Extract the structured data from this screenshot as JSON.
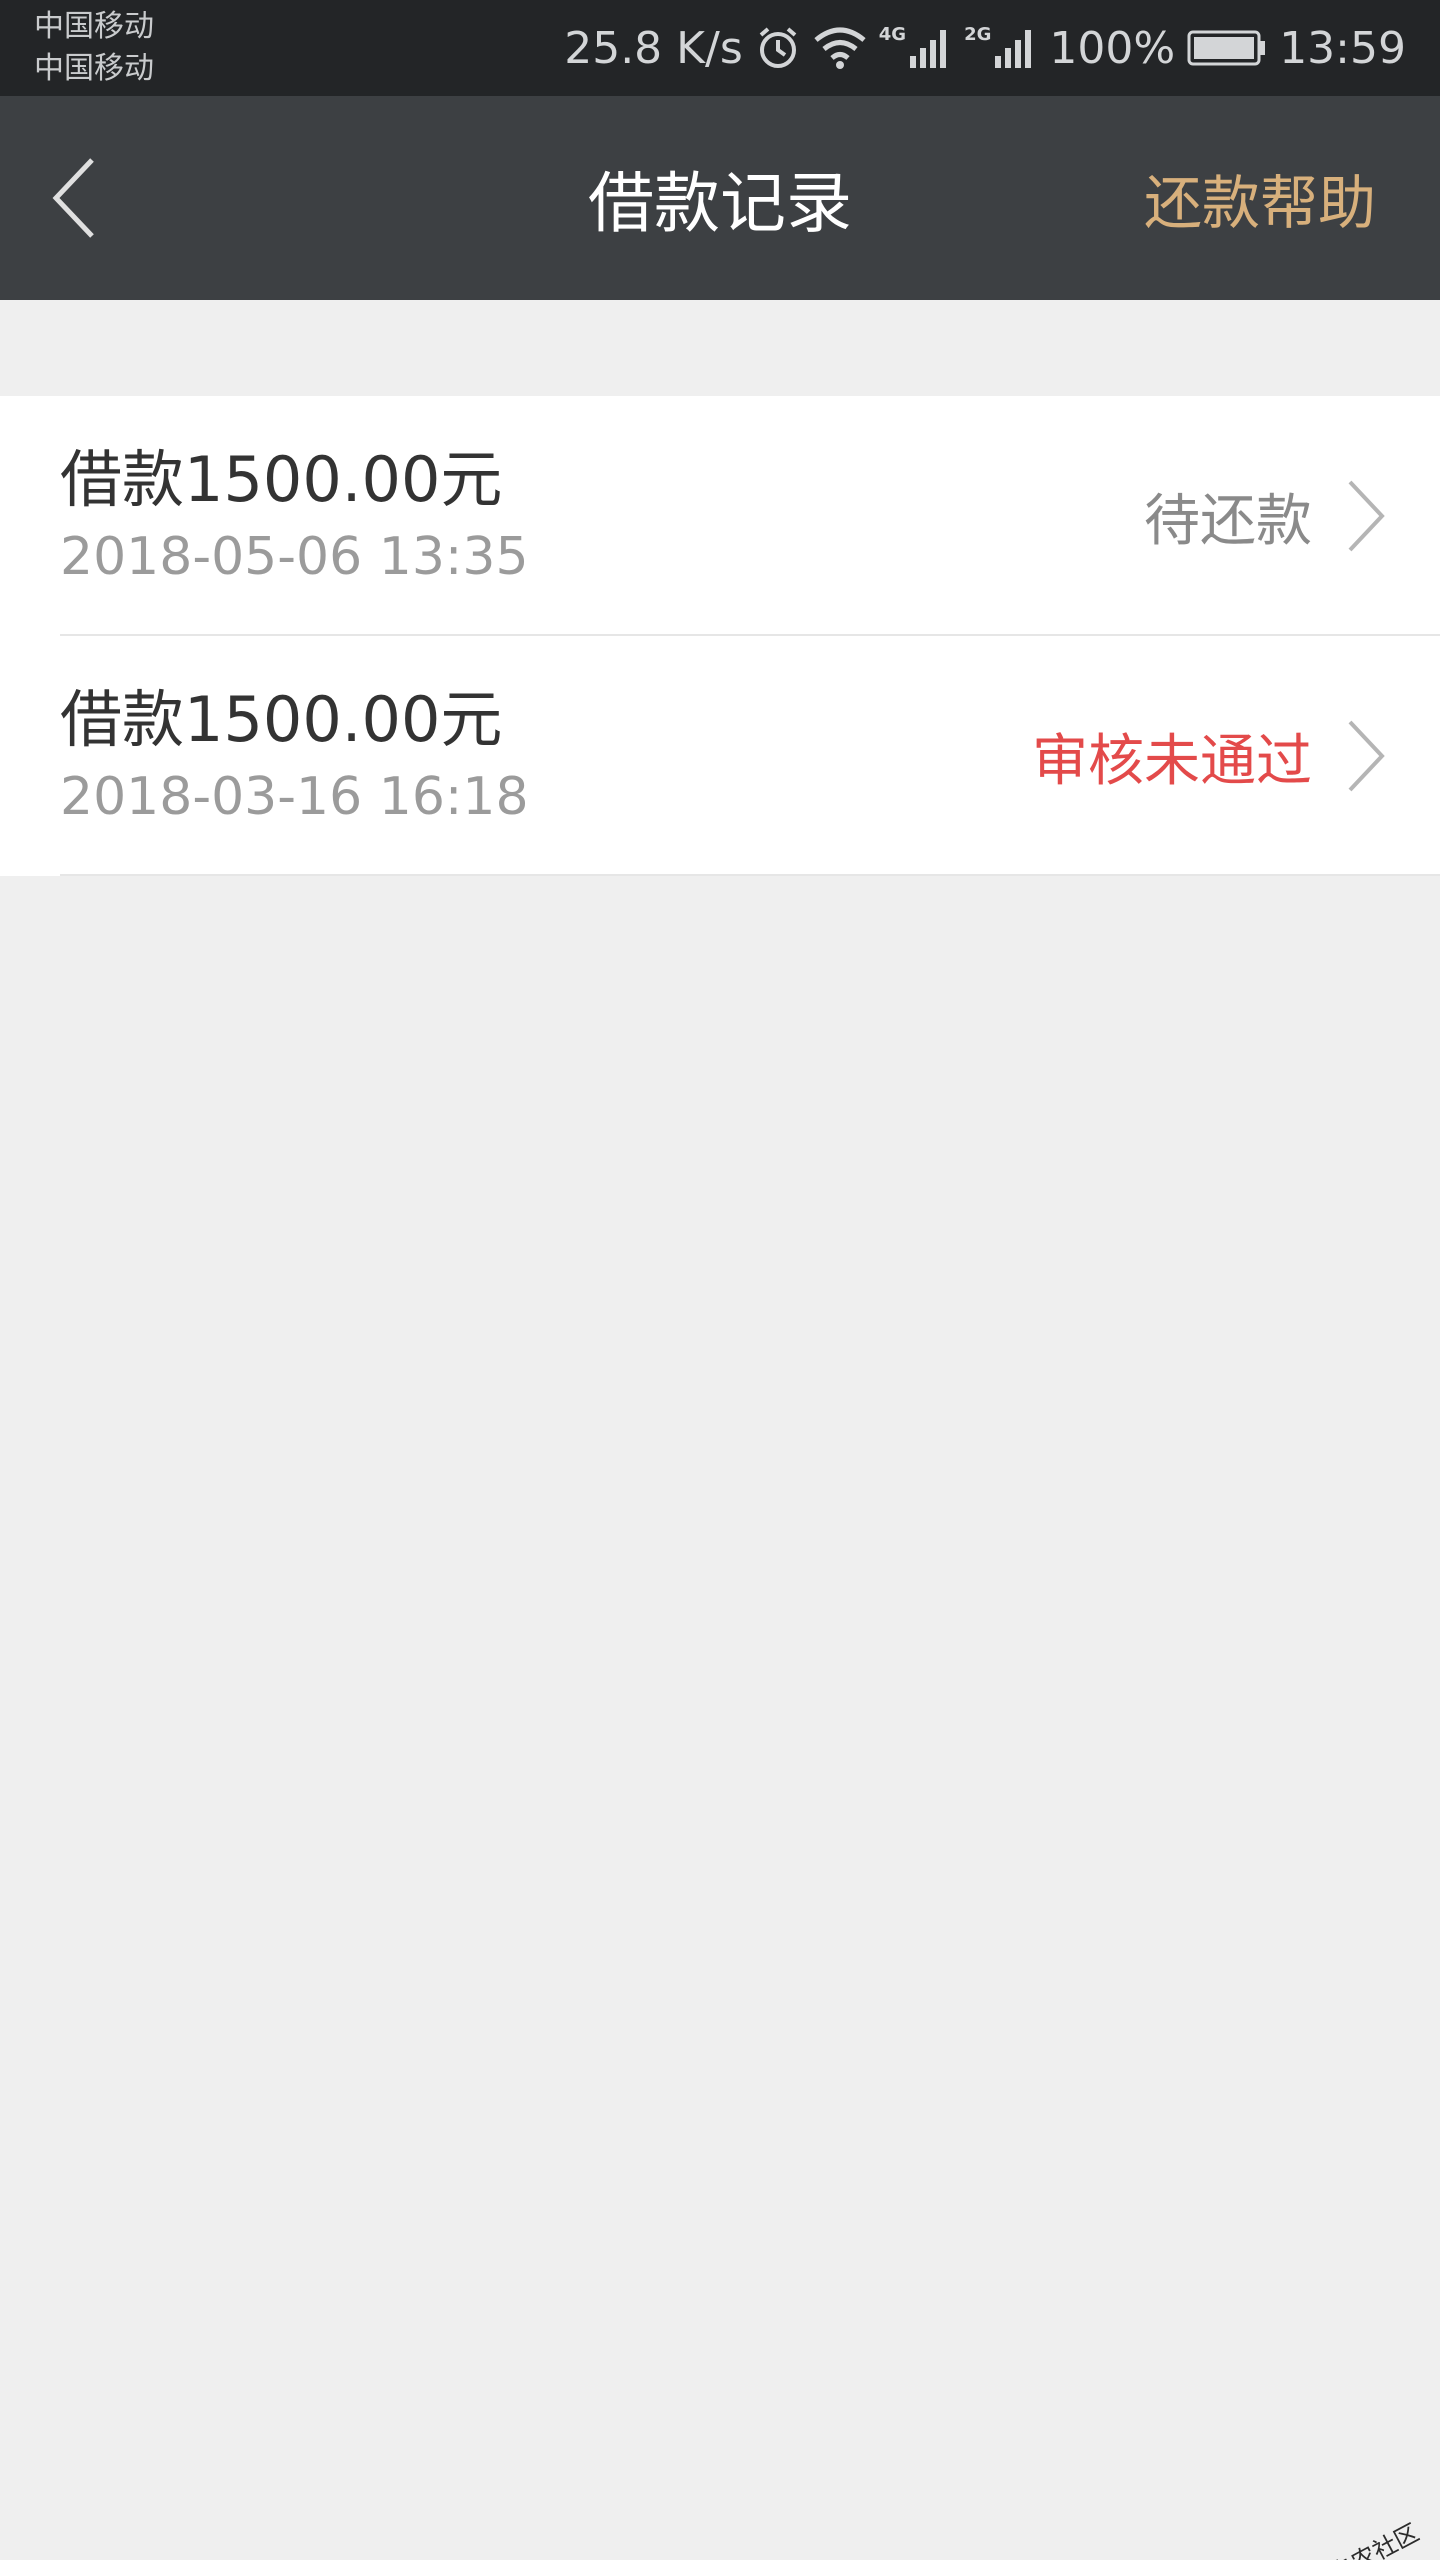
{
  "status_bar": {
    "carrier_1": "中国移动",
    "carrier_2": "中国移动",
    "net_speed": "25.8 K/s",
    "sim1_network": "4G",
    "sim2_network": "2G",
    "battery": "100%",
    "time": "13:59"
  },
  "nav": {
    "title": "借款记录",
    "action_label": "还款帮助"
  },
  "records": [
    {
      "title": "借款1500.00元",
      "date": "2018-05-06 13:35",
      "status": "待还款",
      "status_color": "#8a8a8a"
    },
    {
      "title": "借款1500.00元",
      "date": "2018-03-16 16:18",
      "status": "审核未通过",
      "status_color": "#e34a4a"
    }
  ],
  "colors": {
    "navbar": "#3d4043",
    "statusbar": "#232527",
    "accent_gold": "#d8b07c",
    "rejected_red": "#e34a4a",
    "background": "#efefef"
  },
  "watermark": {
    "text": "卡农社区"
  }
}
